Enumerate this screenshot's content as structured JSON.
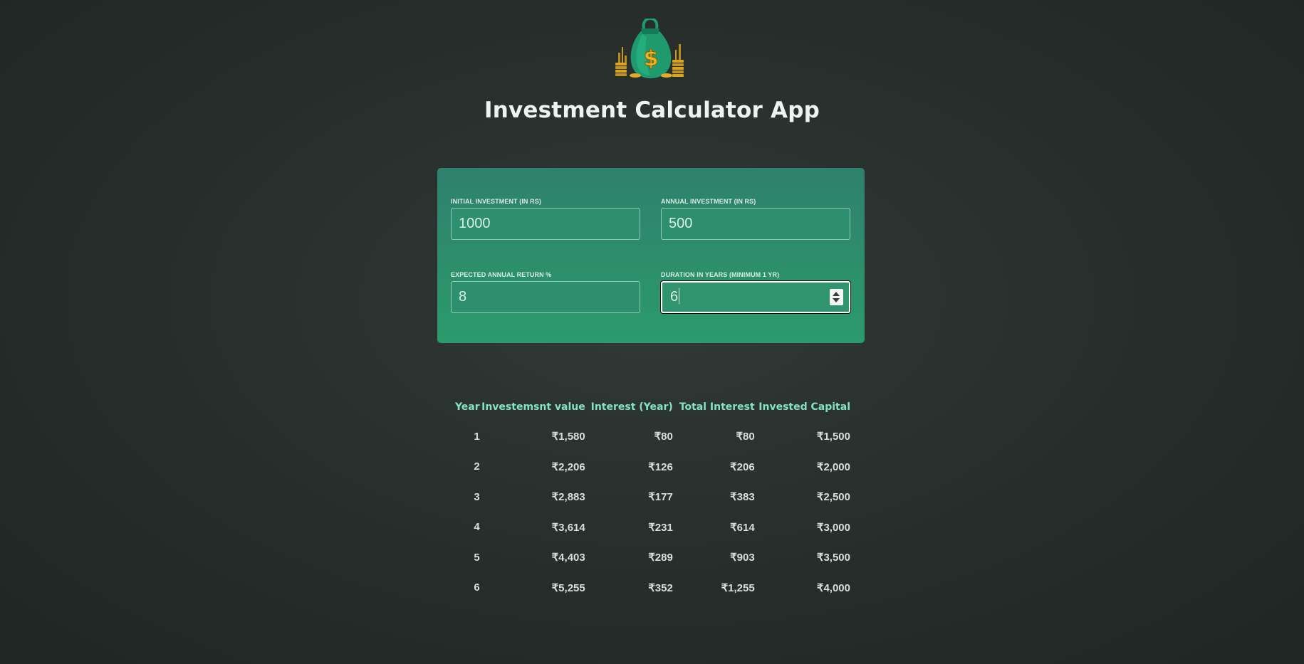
{
  "header": {
    "title": "Investment Calculator App",
    "logo_icon": "money-bag-icon"
  },
  "inputs": {
    "initial_investment": {
      "label": "INITIAL INVESTMENT (IN RS)",
      "value": "1000"
    },
    "annual_investment": {
      "label": "ANNUAL INVESTMENT (IN RS)",
      "value": "500"
    },
    "expected_return": {
      "label": "EXPECTED ANNUAL RETURN %",
      "value": "8"
    },
    "duration": {
      "label": "DURATION IN YEARS (MINIMUM 1 YR)",
      "value": "6"
    }
  },
  "table": {
    "headers": [
      "Year",
      "Investemsnt value",
      "Interest (Year)",
      "Total Interest",
      "Invested Capital"
    ],
    "rows": [
      [
        "1",
        "₹1,580",
        "₹80",
        "₹80",
        "₹1,500"
      ],
      [
        "2",
        "₹2,206",
        "₹126",
        "₹206",
        "₹2,000"
      ],
      [
        "3",
        "₹2,883",
        "₹177",
        "₹383",
        "₹2,500"
      ],
      [
        "4",
        "₹3,614",
        "₹231",
        "₹614",
        "₹3,000"
      ],
      [
        "5",
        "₹4,403",
        "₹289",
        "₹903",
        "₹3,500"
      ],
      [
        "6",
        "₹5,255",
        "₹352",
        "₹1,255",
        "₹4,000"
      ]
    ]
  },
  "colors": {
    "background": "#262d2b",
    "card_top": "#2f806d",
    "card_bottom": "#2b9a6c",
    "header_accent": "#82e3bf"
  }
}
